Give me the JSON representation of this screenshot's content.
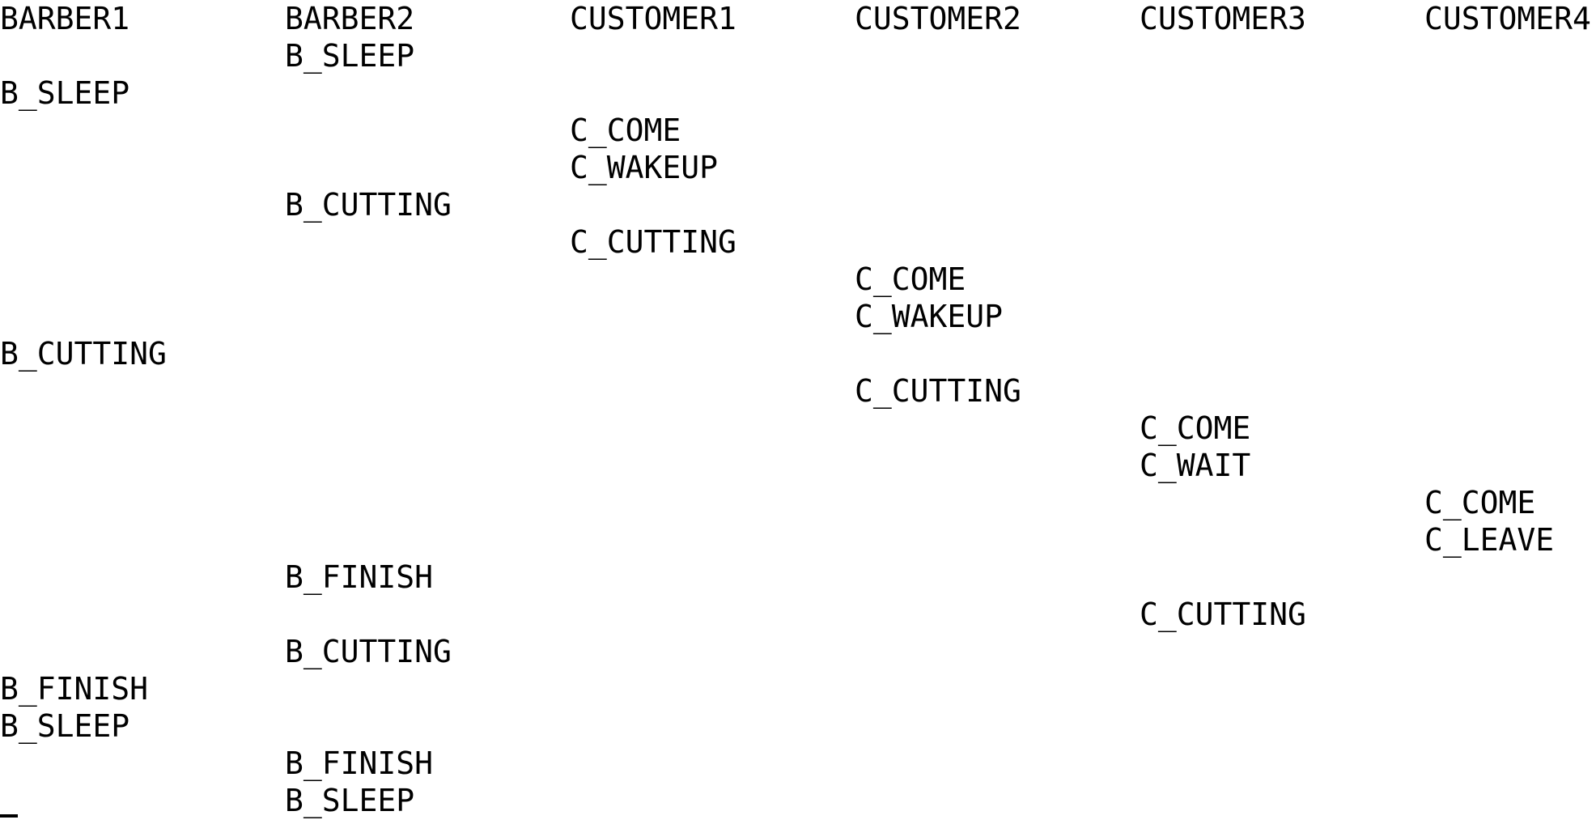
{
  "columns": [
    "BARBER1",
    "BARBER2",
    "CUSTOMER1",
    "CUSTOMER2",
    "CUSTOMER3",
    "CUSTOMER4"
  ],
  "rows": [
    [
      "",
      "B_SLEEP",
      "",
      "",
      "",
      ""
    ],
    [
      "B_SLEEP",
      "",
      "",
      "",
      "",
      ""
    ],
    [
      "",
      "",
      "C_COME",
      "",
      "",
      ""
    ],
    [
      "",
      "",
      "C_WAKEUP",
      "",
      "",
      ""
    ],
    [
      "",
      "B_CUTTING",
      "",
      "",
      "",
      ""
    ],
    [
      "",
      "",
      "C_CUTTING",
      "",
      "",
      ""
    ],
    [
      "",
      "",
      "",
      "C_COME",
      "",
      ""
    ],
    [
      "",
      "",
      "",
      "C_WAKEUP",
      "",
      ""
    ],
    [
      "B_CUTTING",
      "",
      "",
      "",
      "",
      ""
    ],
    [
      "",
      "",
      "",
      "C_CUTTING",
      "",
      ""
    ],
    [
      "",
      "",
      "",
      "",
      "C_COME",
      ""
    ],
    [
      "",
      "",
      "",
      "",
      "C_WAIT",
      ""
    ],
    [
      "",
      "",
      "",
      "",
      "",
      "C_COME"
    ],
    [
      "",
      "",
      "",
      "",
      "",
      "C_LEAVE"
    ],
    [
      "",
      "B_FINISH",
      "",
      "",
      "",
      ""
    ],
    [
      "",
      "",
      "",
      "",
      "C_CUTTING",
      ""
    ],
    [
      "",
      "B_CUTTING",
      "",
      "",
      "",
      ""
    ],
    [
      "B_FINISH",
      "",
      "",
      "",
      "",
      ""
    ],
    [
      "B_SLEEP",
      "",
      "",
      "",
      "",
      ""
    ],
    [
      "",
      "B_FINISH",
      "",
      "",
      "",
      ""
    ],
    [
      "",
      "B_SLEEP",
      "",
      "",
      "",
      ""
    ]
  ]
}
